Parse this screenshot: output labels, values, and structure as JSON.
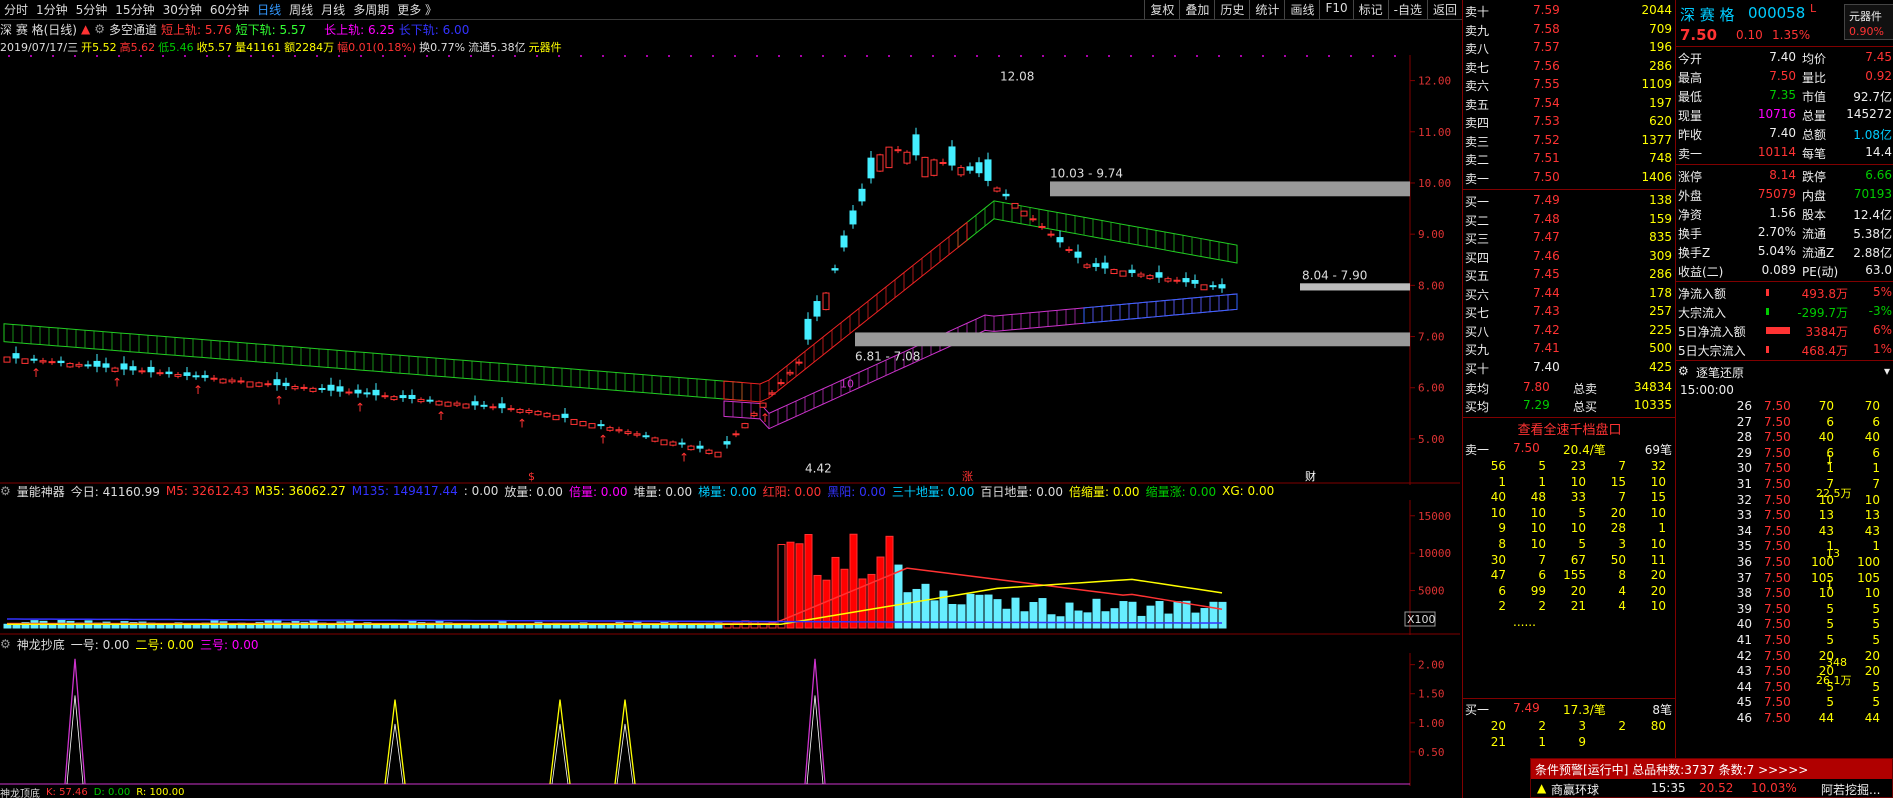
{
  "toolbar": {
    "periods": [
      "分时",
      "1分钟",
      "5分钟",
      "15分钟",
      "30分钟",
      "60分钟",
      "日线",
      "周线",
      "月线",
      "多周期",
      "更多 》"
    ],
    "active_period": "日线",
    "buttons": [
      "复权",
      "叠加",
      "历史",
      "统计",
      "画线",
      "F10",
      "标记",
      "-自选",
      "返回"
    ]
  },
  "chart_info": {
    "stock_label": "深 赛 格(日线)",
    "indicator": "多空通道",
    "short_up": "短上轨: 5.76",
    "short_down": "短下轨: 5.57",
    "long_up": "长上轨: 6.25",
    "long_down": "长下轨: 6.00"
  },
  "ohlc": {
    "date": "2019/07/17/三",
    "open": "开5.52",
    "high": "高5.62",
    "low": "低5.46",
    "close": "收5.57",
    "volume": "量41161",
    "amount": "额2284万",
    "amplitude": "幅0.01(0.18%)",
    "turnover": "换0.77%",
    "float": "流通5.38亿",
    "elem": "元器件"
  },
  "price_axis": [
    "12.00",
    "11.00",
    "10.00",
    "9.00",
    "8.00",
    "7.00",
    "6.00",
    "5.00"
  ],
  "annotations": {
    "high": "12.08",
    "low": "4.42",
    "band1": "10.03 - 9.74",
    "band2": "6.81 - 7.08",
    "band3": "8.04 - 7.90",
    "marker10": "10",
    "zhang": "涨",
    "cai": "财",
    "s_mark": "$"
  },
  "vol_indicator": {
    "name": "量能神器",
    "today": "今日: 41160.99",
    "m5": "M5: 32612.43",
    "m35": "M35: 36062.27",
    "m135": "M135: 149417.44",
    "v1": ": 0.00",
    "fangliang": "放量: 0.00",
    "beiliang": "倍量: 0.00",
    "duiliang": "堆量: 0.00",
    "tiliang": "梯量: 0.00",
    "hongyang": "红阳: 0.00",
    "heiyang": "黑阳: 0.00",
    "sanshi": "三十地量: 0.00",
    "bairi": "百日地量: 0.00",
    "beisuo": "倍缩量: 0.00",
    "suozhang": "缩量涨: 0.00",
    "xg": "XG: 0.00"
  },
  "vol_axis": [
    "15000",
    "10000",
    "5000"
  ],
  "x100": "X100",
  "sub_indicator": {
    "name": "神龙抄底",
    "one": "一号: 0.00",
    "two": "二号: 0.00",
    "three": "三号: 0.00"
  },
  "sub_axis": [
    "2.00",
    "1.50",
    "1.00",
    "0.50"
  ],
  "bottom_indicator": {
    "name": "神龙顶底",
    "k": "K: 57.46",
    "d": "D: 0.00",
    "r": "R: 100.00"
  },
  "orderbook": {
    "asks": [
      {
        "label": "卖十",
        "price": "7.59",
        "vol": "2044"
      },
      {
        "label": "卖九",
        "price": "7.58",
        "vol": "709"
      },
      {
        "label": "卖八",
        "price": "7.57",
        "vol": "196"
      },
      {
        "label": "卖七",
        "price": "7.56",
        "vol": "286"
      },
      {
        "label": "卖六",
        "price": "7.55",
        "vol": "1109"
      },
      {
        "label": "卖五",
        "price": "7.54",
        "vol": "197"
      },
      {
        "label": "卖四",
        "price": "7.53",
        "vol": "620"
      },
      {
        "label": "卖三",
        "price": "7.52",
        "vol": "1377"
      },
      {
        "label": "卖二",
        "price": "7.51",
        "vol": "748"
      },
      {
        "label": "卖一",
        "price": "7.50",
        "vol": "1406"
      }
    ],
    "bids": [
      {
        "label": "买一",
        "price": "7.49",
        "vol": "138"
      },
      {
        "label": "买二",
        "price": "7.48",
        "vol": "159"
      },
      {
        "label": "买三",
        "price": "7.47",
        "vol": "835"
      },
      {
        "label": "买四",
        "price": "7.46",
        "vol": "309"
      },
      {
        "label": "买五",
        "price": "7.45",
        "vol": "286"
      },
      {
        "label": "买六",
        "price": "7.44",
        "vol": "178"
      },
      {
        "label": "买七",
        "price": "7.43",
        "vol": "257"
      },
      {
        "label": "买八",
        "price": "7.42",
        "vol": "225"
      },
      {
        "label": "买九",
        "price": "7.41",
        "vol": "500"
      },
      {
        "label": "买十",
        "price": "7.40",
        "vol": "425"
      }
    ],
    "avg_sell_label": "卖均",
    "avg_sell": "7.80",
    "total_sell_label": "总卖",
    "total_sell": "34834",
    "avg_buy_label": "买均",
    "avg_buy": "7.29",
    "total_buy_label": "总买",
    "total_buy": "10335",
    "view_all": "查看全速千档盘口",
    "s1_label": "卖一",
    "s1_price": "7.50",
    "s1_per": "20.4/笔",
    "s1_count": "69笔",
    "s1_grid": [
      [
        "56",
        "5",
        "23",
        "7",
        "32"
      ],
      [
        "1",
        "1",
        "10",
        "15",
        "10"
      ],
      [
        "40",
        "48",
        "33",
        "7",
        "15"
      ],
      [
        "10",
        "10",
        "5",
        "20",
        "10"
      ],
      [
        "9",
        "10",
        "10",
        "28",
        "1"
      ],
      [
        "8",
        "10",
        "5",
        "3",
        "10"
      ],
      [
        "30",
        "7",
        "67",
        "50",
        "11"
      ],
      [
        "47",
        "6",
        "155",
        "8",
        "20"
      ],
      [
        "6",
        "99",
        "20",
        "4",
        "20"
      ],
      [
        "2",
        "2",
        "21",
        "4",
        "10"
      ]
    ],
    "s1_more": "......",
    "b1_label": "买一",
    "b1_price": "7.49",
    "b1_per": "17.3/笔",
    "b1_count": "8笔",
    "b1_grid": [
      [
        "20",
        "2",
        "3",
        "2",
        "80"
      ],
      [
        "21",
        "1",
        "9",
        "",
        ""
      ]
    ]
  },
  "quote": {
    "name": "深 赛 格",
    "code": "000058",
    "flag": "L",
    "price": "7.50",
    "change": "0.10",
    "pct": "1.35%",
    "side_label": "元器件",
    "side_pct": "0.90%",
    "rows": [
      {
        "l1": "今开",
        "v1": "7.40",
        "l2": "均价",
        "v2": "7.45"
      },
      {
        "l1": "最高",
        "v1": "7.50",
        "l2": "量比",
        "v2": "0.92"
      },
      {
        "l1": "最低",
        "v1": "7.35",
        "l2": "市值",
        "v2": "92.7亿"
      },
      {
        "l1": "现量",
        "v1": "10716",
        "l2": "总量",
        "v2": "145272"
      },
      {
        "l1": "昨收",
        "v1": "7.40",
        "l2": "总额",
        "v2": "1.08亿"
      },
      {
        "l1": "卖一",
        "v1": "10114",
        "l2": "每笔",
        "v2": "14.4"
      }
    ],
    "rows2": [
      {
        "l1": "涨停",
        "v1": "8.14",
        "l2": "跌停",
        "v2": "6.66"
      },
      {
        "l1": "外盘",
        "v1": "75079",
        "l2": "内盘",
        "v2": "70193"
      },
      {
        "l1": "净资",
        "v1": "1.56",
        "l2": "股本",
        "v2": "12.4亿"
      },
      {
        "l1": "换手",
        "v1": "2.70%",
        "l2": "流通",
        "v2": "5.38亿"
      },
      {
        "l1": "换手Z",
        "v1": "5.04%",
        "l2": "流通Z",
        "v2": "2.88亿"
      },
      {
        "l1": "收益(二)",
        "v1": "0.089",
        "l2": "PE(动)",
        "v2": "63.0"
      }
    ],
    "flows": [
      {
        "label": "净流入额",
        "val": "493.8万",
        "pct": "5%"
      },
      {
        "label": "大宗流入",
        "val": "-299.7万",
        "pct": "-3%"
      },
      {
        "label": "5日净流入额",
        "val": "3384万",
        "pct": "6%"
      },
      {
        "label": "5日大宗流入",
        "val": "468.4万",
        "pct": "1%"
      }
    ],
    "ticks_title": "逐笔还原",
    "ticks_start": "15:00:00",
    "ticks": [
      [
        "26",
        "7.50",
        "70",
        "70"
      ],
      [
        "27",
        "7.50",
        "6",
        "6"
      ],
      [
        "28",
        "7.50",
        "40",
        "40"
      ],
      [
        "29",
        "7.50",
        "6",
        "6"
      ],
      [
        "30",
        "7.50",
        "1",
        "1"
      ],
      [
        "31",
        "7.50",
        "7",
        "7"
      ],
      [
        "32",
        "7.50",
        "10",
        "10"
      ],
      [
        "33",
        "7.50",
        "13",
        "13"
      ],
      [
        "34",
        "7.50",
        "43",
        "43"
      ],
      [
        "35",
        "7.50",
        "1",
        "1"
      ],
      [
        "36",
        "7.50",
        "100",
        "100"
      ],
      [
        "37",
        "7.50",
        "105",
        "105"
      ],
      [
        "38",
        "7.50",
        "10",
        "10"
      ],
      [
        "39",
        "7.50",
        "5",
        "5"
      ],
      [
        "40",
        "7.50",
        "5",
        "5"
      ],
      [
        "41",
        "7.50",
        "5",
        "5"
      ],
      [
        "42",
        "7.50",
        "20",
        "20"
      ],
      [
        "43",
        "7.50",
        "20",
        "20"
      ],
      [
        "44",
        "7.50",
        "5",
        "5"
      ],
      [
        "45",
        "7.50",
        "5",
        "5"
      ],
      [
        "46",
        "7.50",
        "44",
        "44"
      ]
    ],
    "tick_side": [
      {
        "row": 4,
        "v": "1"
      },
      {
        "row": 6,
        "v": "22.5万"
      },
      {
        "row": 10,
        "v": "13"
      },
      {
        "row": 12,
        "v": "1"
      },
      {
        "row": 17,
        "v": "348"
      },
      {
        "row": 18,
        "v": "26.1万"
      }
    ]
  },
  "alert": {
    "title": "条件预警[运行中] 总品种数:3737 条数:7 >>>>>",
    "row": {
      "name": "商赢环球",
      "time": "15:35",
      "val1": "20.52",
      "val2": "10.03%",
      "note": "阿若挖掘..."
    }
  }
}
